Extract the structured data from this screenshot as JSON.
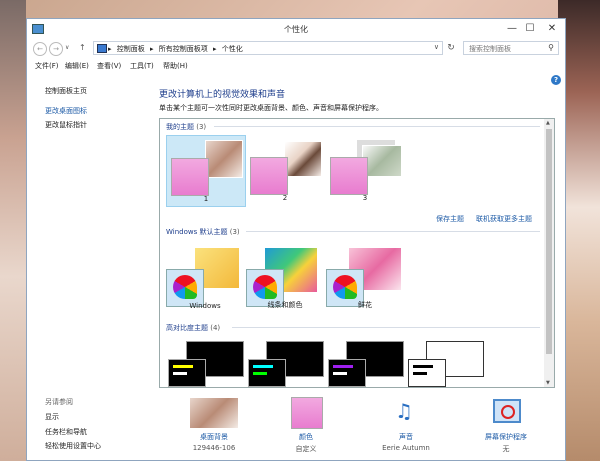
{
  "window": {
    "title": "个性化"
  },
  "titlebar": {
    "min": "—",
    "max": "☐",
    "close": "✕"
  },
  "nav": {
    "back": "←",
    "forward": "→",
    "history": "∨",
    "up": "↑",
    "refresh": "↻"
  },
  "address": {
    "crumbs": [
      "控制面板",
      "所有控制面板项",
      "个性化"
    ],
    "sep": "▸",
    "dropdown": "∨"
  },
  "search": {
    "placeholder": "搜索控制面板",
    "icon": "⚲"
  },
  "menu": [
    {
      "label": "文件(F)"
    },
    {
      "label": "编辑(E)"
    },
    {
      "label": "查看(V)"
    },
    {
      "label": "工具(T)"
    },
    {
      "label": "帮助(H)"
    }
  ],
  "help": "?",
  "sidebar": {
    "home": "控制面板主页",
    "items": [
      "更改桌面图标",
      "更改鼠标指针"
    ],
    "see_also": "另请参阅",
    "see_also_items": [
      "显示",
      "任务栏和导航",
      "轻松使用设置中心"
    ]
  },
  "main": {
    "heading": "更改计算机上的视觉效果和声音",
    "subheading": "单击某个主题可一次性同时更改桌面背景、颜色、声音和屏幕保护程序。"
  },
  "sections": {
    "mine": {
      "title": "我的主题",
      "count": "(3)",
      "themes": [
        "1",
        "2",
        "3"
      ]
    },
    "links": {
      "save": "保存主题",
      "online": "联机获取更多主题"
    },
    "default": {
      "title": "Windows 默认主题",
      "count": "(3)",
      "themes": [
        "Windows",
        "线条和颜色",
        "鲜花"
      ]
    },
    "hc": {
      "title": "高对比度主题",
      "count": "(4)"
    }
  },
  "scroll": {
    "up": "▲",
    "down": "▼"
  },
  "bottom": [
    {
      "label": "桌面背景",
      "value": "129446-106"
    },
    {
      "label": "颜色",
      "value": "自定义"
    },
    {
      "label": "声音",
      "value": "Eerie Autumn"
    },
    {
      "label": "屏幕保护程序",
      "value": "无"
    }
  ]
}
